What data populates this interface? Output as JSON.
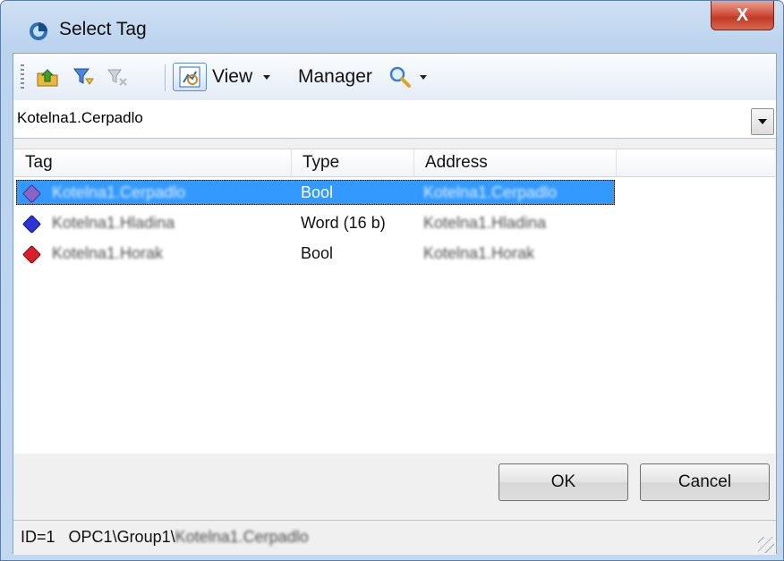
{
  "window": {
    "title": "Select Tag",
    "close_label": "X"
  },
  "toolbar": {
    "view_label": "View",
    "manager_label": "Manager",
    "icons": [
      "up-folder-icon",
      "filter-icon",
      "clear-filter-icon",
      "tag-browser-icon",
      "search-icon"
    ]
  },
  "combo": {
    "value": "Kotelna1.Cerpadlo"
  },
  "table": {
    "columns": [
      "Tag",
      "Type",
      "Address"
    ],
    "rows": [
      {
        "tag": "Kotelna1.Cerpadlo",
        "type": "Bool",
        "address": "Kotelna1.Cerpadlo",
        "icon_color": "#8a63c7",
        "selected": true
      },
      {
        "tag": "Kotelna1.Hladina",
        "type": "Word (16 b)",
        "address": "Kotelna1.Hladina",
        "icon_color": "#2b34d6",
        "selected": false
      },
      {
        "tag": "Kotelna1.Horak",
        "type": "Bool",
        "address": "Kotelna1.Horak",
        "icon_color": "#d9202a",
        "selected": false
      }
    ]
  },
  "buttons": {
    "ok": "OK",
    "cancel": "Cancel"
  },
  "status": {
    "id": "ID=1",
    "path": "OPC1\\Group1\\",
    "path_tail": "Kotelna1.Cerpadlo"
  },
  "colors": {
    "selection": "#3399ff",
    "close_button": "#c8432e"
  }
}
